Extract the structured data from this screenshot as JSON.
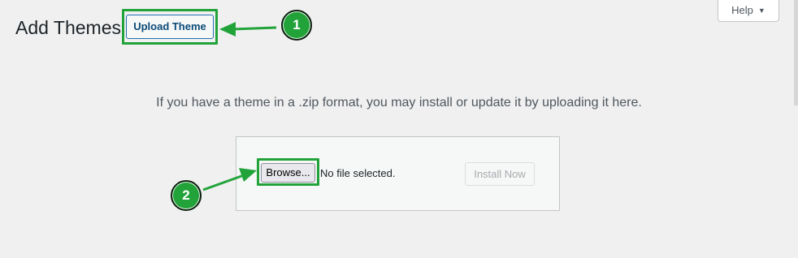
{
  "header": {
    "title": "Add Themes",
    "upload_button_label": "Upload Theme",
    "help_label": "Help",
    "help_caret": "▼"
  },
  "upload": {
    "instructions": "If you have a theme in a .zip format, you may install or update it by uploading it here.",
    "browse_label": "Browse...",
    "file_status": "No file selected.",
    "install_label": "Install Now"
  },
  "annotations": {
    "callout_1": "1",
    "callout_2": "2",
    "color": "#22a33a"
  }
}
